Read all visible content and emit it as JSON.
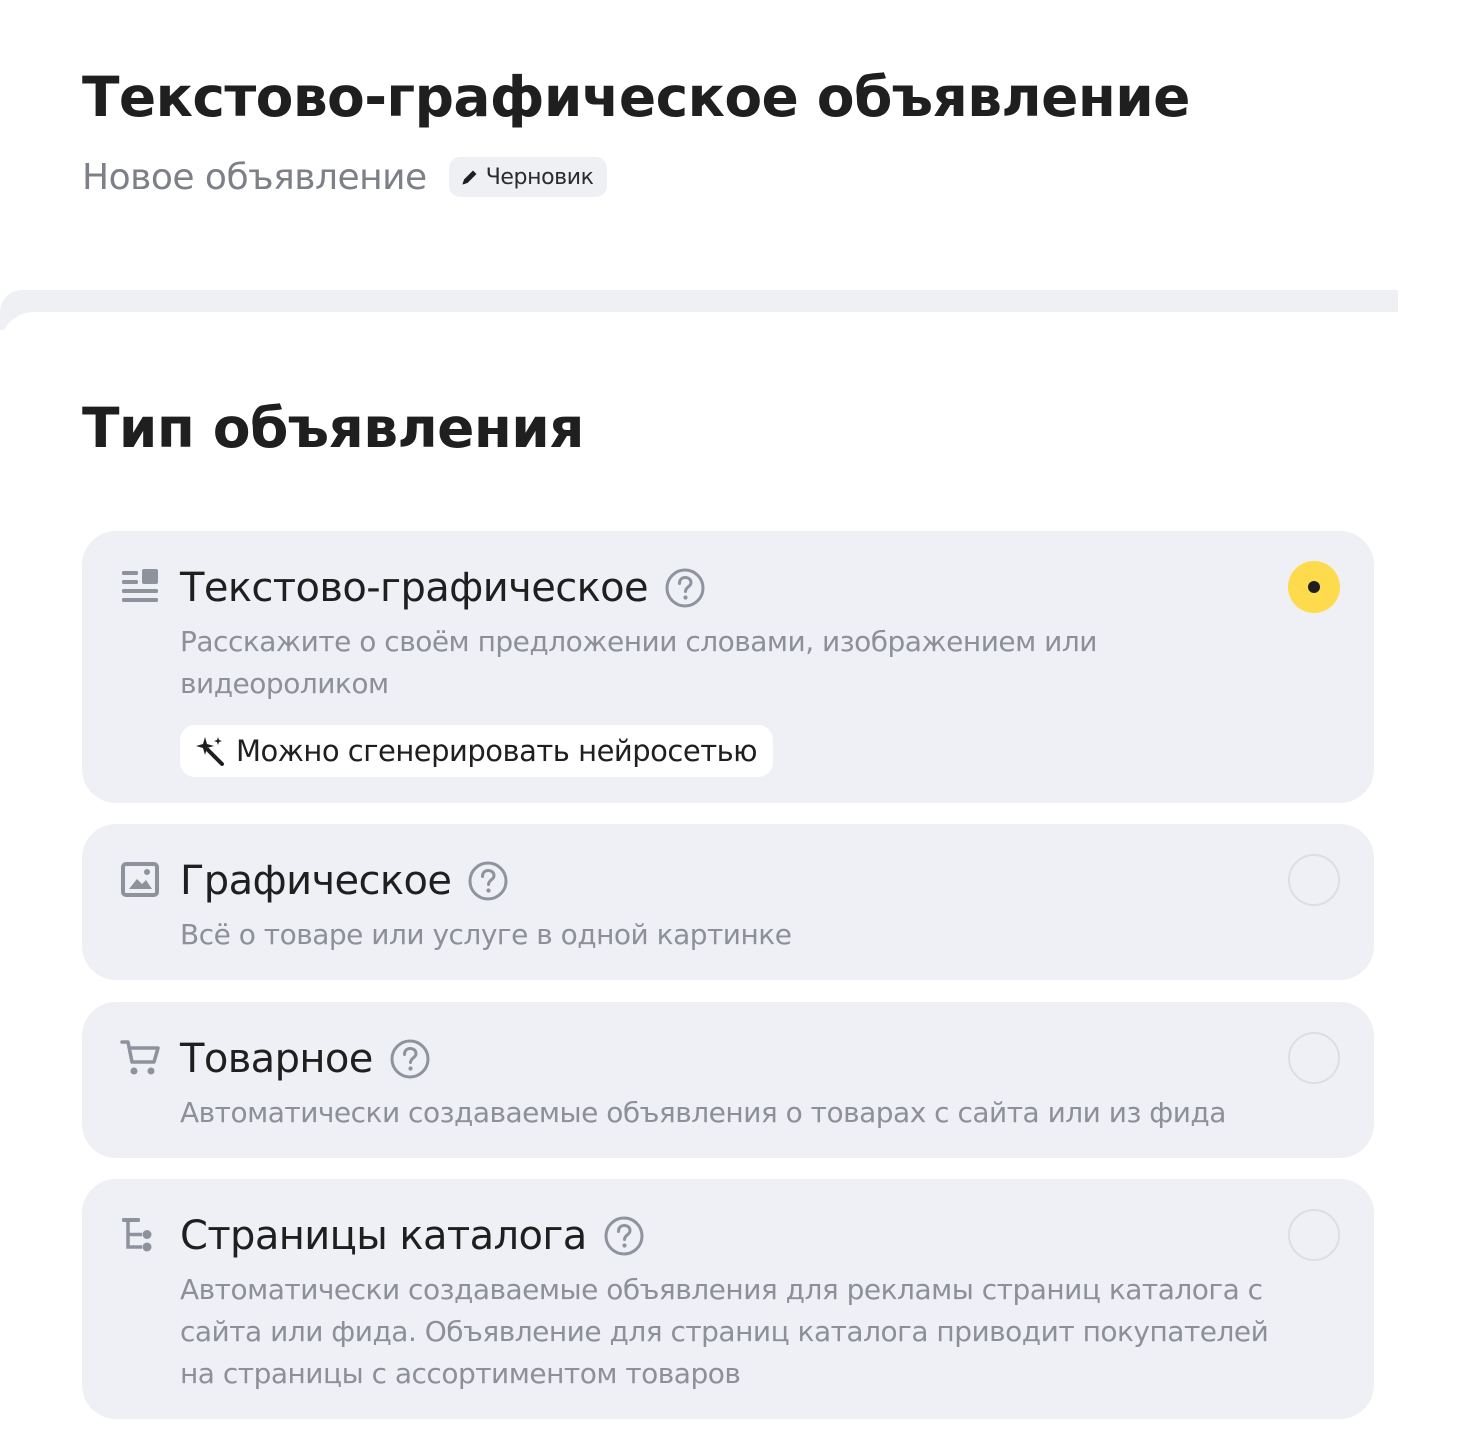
{
  "header": {
    "title": "Текстово-графическое объявление",
    "subtitle": "Новое объявление",
    "badge_label": "Черновик",
    "badge_icon": "pencil-icon"
  },
  "section": {
    "title": "Тип объявления"
  },
  "ad_types": [
    {
      "title": "Текстово-графическое",
      "description": "Расскажите о своём предложении словами, изображением или видеороликом",
      "chip_label": "Можно сгенерировать нейросетью",
      "chip_icon": "magic-wand-icon",
      "icon": "text-graphic-icon",
      "selected": true
    },
    {
      "title": "Графическое",
      "description": "Всё о товаре или услуге в одной картинке",
      "icon": "image-icon",
      "selected": false
    },
    {
      "title": "Товарное",
      "description": "Автоматически создаваемые объявления о товарах с сайта или из фида",
      "icon": "shopping-cart-icon",
      "selected": false
    },
    {
      "title": "Страницы каталога",
      "description": "Автоматически создаваемые объявления для рекламы страниц каталога с сайта или фида. Объявление для страниц каталога приводит покупателей на страницы с ассортиментом товаров",
      "icon": "catalog-tree-icon",
      "selected": false
    }
  ],
  "colors": {
    "accent_yellow": "#fedb4d",
    "card_background": "#eff0f5",
    "muted_text": "#8d9099"
  }
}
